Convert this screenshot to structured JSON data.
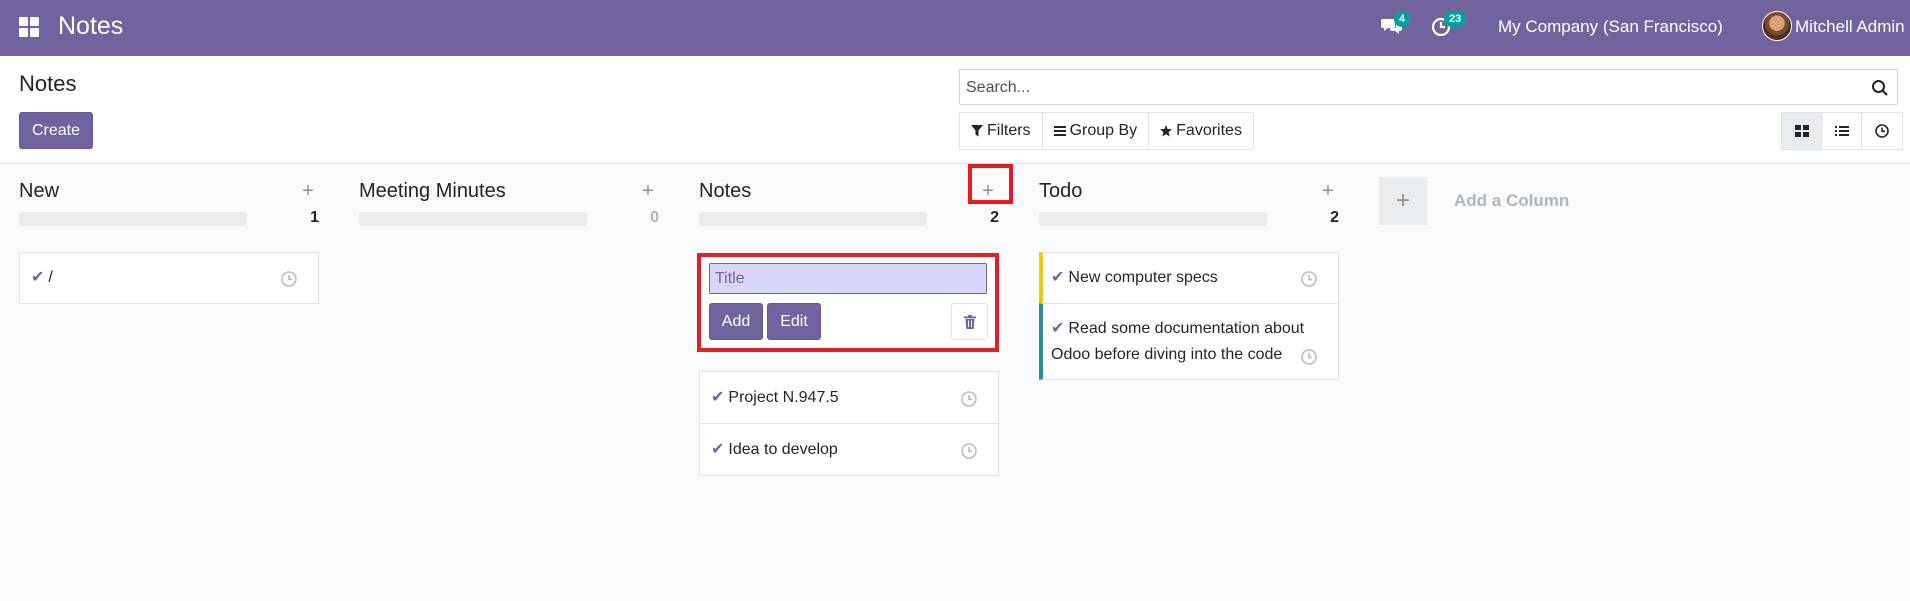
{
  "navbar": {
    "app_title": "Notes",
    "messages_badge": "4",
    "activities_badge": "23",
    "company": "My Company (San Francisco)",
    "user": "Mitchell Admin",
    "color": "#71639e"
  },
  "control": {
    "breadcrumb": "Notes",
    "create_label": "Create",
    "search_placeholder": "Search...",
    "filters_label": "Filters",
    "groupby_label": "Group By",
    "favorites_label": "Favorites"
  },
  "columns": [
    {
      "title": "New",
      "count": "1",
      "cards": [
        {
          "text": "/"
        }
      ]
    },
    {
      "title": "Meeting Minutes",
      "count": "0",
      "cards": []
    },
    {
      "title": "Notes",
      "count": "2",
      "cards": [
        {
          "text": "Project N.947.5"
        },
        {
          "text": "Idea to develop"
        }
      ]
    },
    {
      "title": "Todo",
      "count": "2",
      "cards": [
        {
          "text": "New computer specs",
          "color": "#f0c419"
        },
        {
          "text": "Read some documentation about Odoo before diving into the code",
          "color": "#2e8b99"
        }
      ]
    }
  ],
  "quick_create": {
    "placeholder": "Title",
    "add_label": "Add",
    "edit_label": "Edit"
  },
  "add_column_label": "Add a Column",
  "icons": {
    "apps": "apps-grid-icon",
    "messages": "chat-bubbles-icon",
    "activities": "clock-icon",
    "search": "search-icon",
    "filters": "funnel-icon",
    "groupby": "bars-icon",
    "favorites": "star-icon",
    "kanban_view": "kanban-grid-icon",
    "list_view": "list-icon",
    "activity_view": "clock-icon",
    "trash": "trash-icon",
    "check": "check-icon"
  }
}
